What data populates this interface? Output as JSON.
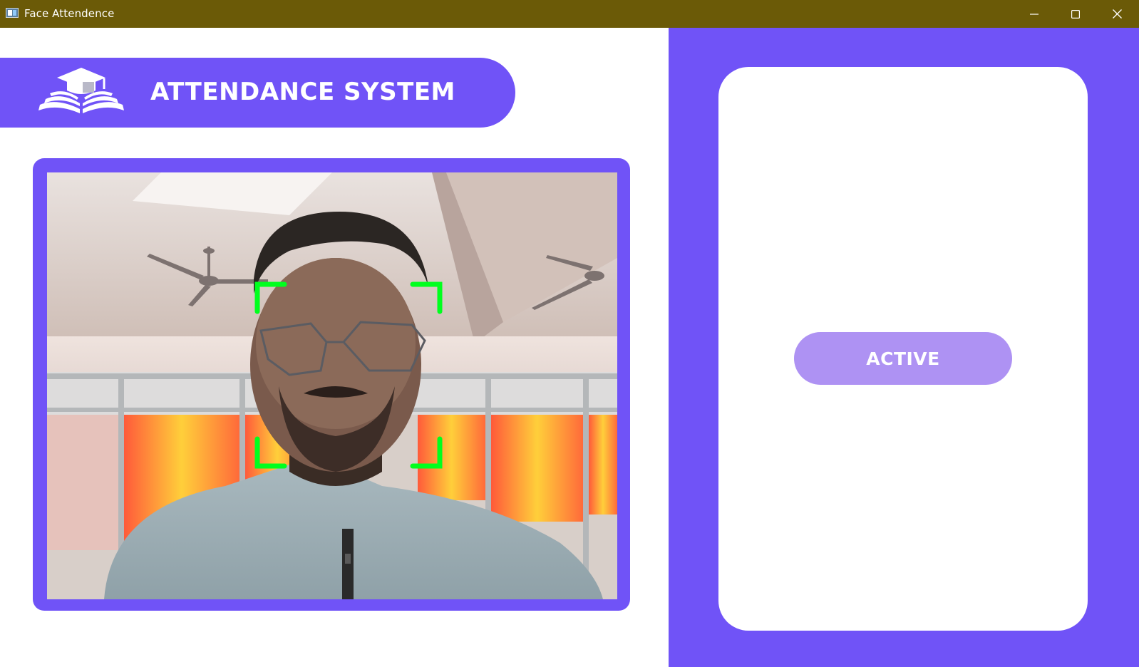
{
  "window": {
    "title": "Face Attendence",
    "icon": "app-window-icon",
    "controls": [
      "minimize-icon",
      "maximize-icon",
      "close-icon"
    ]
  },
  "header": {
    "title": "ATTENDANCE SYSTEM",
    "icon": "graduation-cap-book-icon"
  },
  "camera": {
    "detection_box_color": "#00ff1e"
  },
  "status": {
    "label": "ACTIVE"
  },
  "colors": {
    "titlebar": "#6b5a07",
    "accent": "#7053f7",
    "status_pill": "#ae92f3",
    "card": "#ffffff"
  }
}
